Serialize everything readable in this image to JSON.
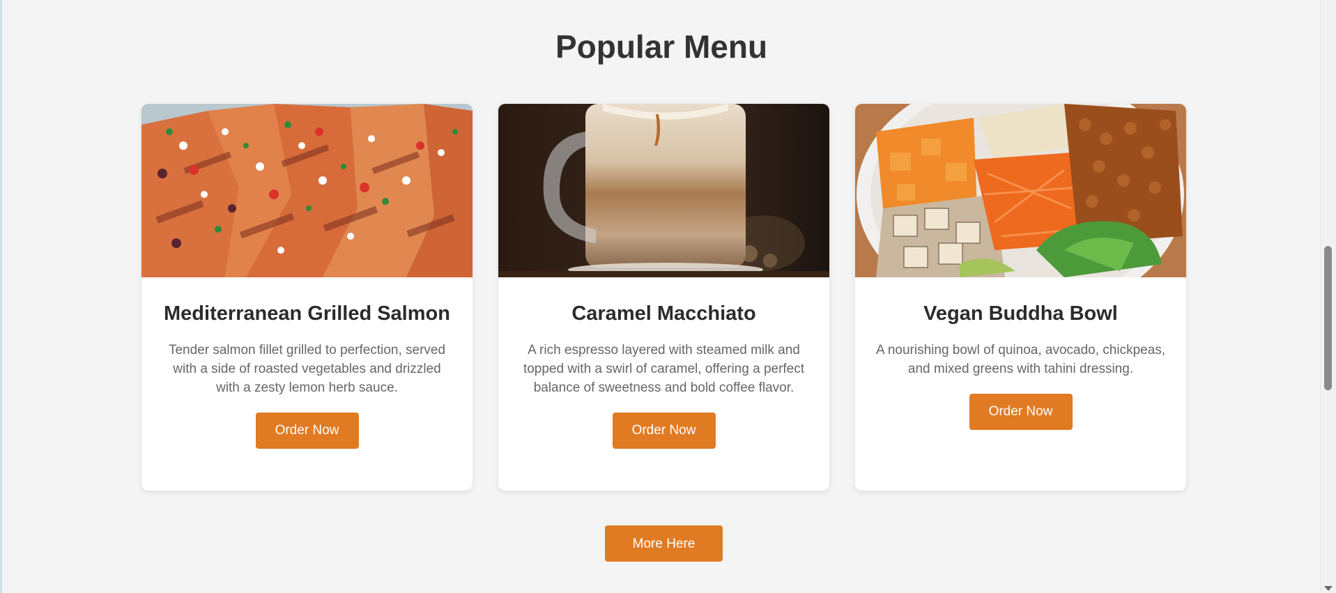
{
  "section": {
    "title": "Popular Menu"
  },
  "cards": [
    {
      "image": "grilled-salmon-photo",
      "title": "Mediterranean Grilled Salmon",
      "description": "Tender salmon fillet grilled to perfection, served with a side of roasted vegetables and drizzled with a zesty lemon herb sauce.",
      "button_label": "Order Now"
    },
    {
      "image": "caramel-macchiato-photo",
      "title": "Caramel Macchiato",
      "description": "A rich espresso layered with steamed milk and topped with a swirl of caramel, offering a perfect balance of sweetness and bold coffee flavor.",
      "button_label": "Order Now"
    },
    {
      "image": "buddha-bowl-photo",
      "title": "Vegan Buddha Bowl",
      "description": "A nourishing bowl of quinoa, avocado, chickpeas, and mixed greens with tahini dressing.",
      "button_label": "Order Now"
    }
  ],
  "more_button": {
    "label": "More Here"
  },
  "colors": {
    "accent": "#e07b24",
    "background": "#f4f4f4",
    "card": "#ffffff"
  }
}
